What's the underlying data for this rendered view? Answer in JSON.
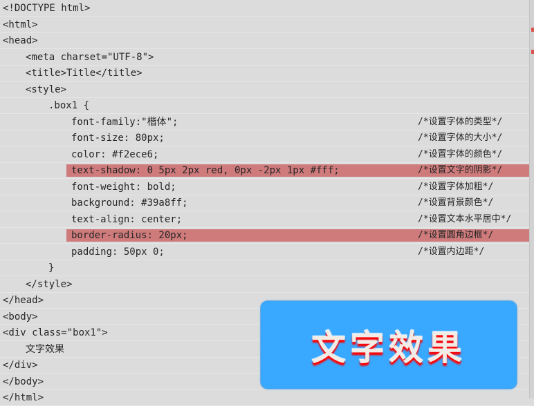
{
  "editor": {
    "lines": [
      {
        "text": "<!DOCTYPE html>",
        "indent": 0
      },
      {
        "text": "<html>",
        "indent": 0
      },
      {
        "text": "<head>",
        "indent": 0
      },
      {
        "text": "<meta charset=\"UTF-8\">",
        "indent": 1
      },
      {
        "text": "<title>Title</title>",
        "indent": 1
      },
      {
        "text": "<style>",
        "indent": 1
      },
      {
        "text": ".box1 {",
        "indent": 2
      },
      {
        "text": "font-family:\"楷体\";",
        "indent": 3,
        "comment": "/*设置字体的类型*/"
      },
      {
        "text": "font-size: 80px;",
        "indent": 3,
        "comment": "/*设置字体的大小*/"
      },
      {
        "text": "color: #f2ece6;",
        "indent": 3,
        "comment": "/*设置字体的颜色*/"
      },
      {
        "text": "text-shadow: 0 5px 2px red, 0px -2px 1px #fff;",
        "indent": 3,
        "comment": "/*设置文字的阴影*/",
        "highlight": true
      },
      {
        "text": "font-weight: bold;",
        "indent": 3,
        "comment": "/*设置字体加粗*/"
      },
      {
        "text": "background: #39a8ff;",
        "indent": 3,
        "comment": "/*设置背景颜色*/"
      },
      {
        "text": "text-align: center;",
        "indent": 3,
        "comment": "/*设置文本水平居中*/"
      },
      {
        "text": "border-radius: 20px;",
        "indent": 3,
        "comment": "/*设置圆角边框*/",
        "highlight": true
      },
      {
        "text": "padding: 50px 0;",
        "indent": 3,
        "comment": "/*设置内边距*/"
      },
      {
        "text": "}",
        "indent": 2
      },
      {
        "text": "</style>",
        "indent": 1
      },
      {
        "text": "</head>",
        "indent": 0
      },
      {
        "text": "<body>",
        "indent": 0
      },
      {
        "text": "<div class=\"box1\">",
        "indent": 0
      },
      {
        "text": "文字效果",
        "indent": 1
      },
      {
        "text": "</div>",
        "indent": 0
      },
      {
        "text": "</body>",
        "indent": 0
      },
      {
        "text": "</html>",
        "indent": 0
      }
    ]
  },
  "preview": {
    "text": "文字效果"
  },
  "colors": {
    "highlight": "#cf7b7c",
    "preview_background": "#39a8ff",
    "preview_text": "#f2ece6",
    "shadow": "red"
  }
}
